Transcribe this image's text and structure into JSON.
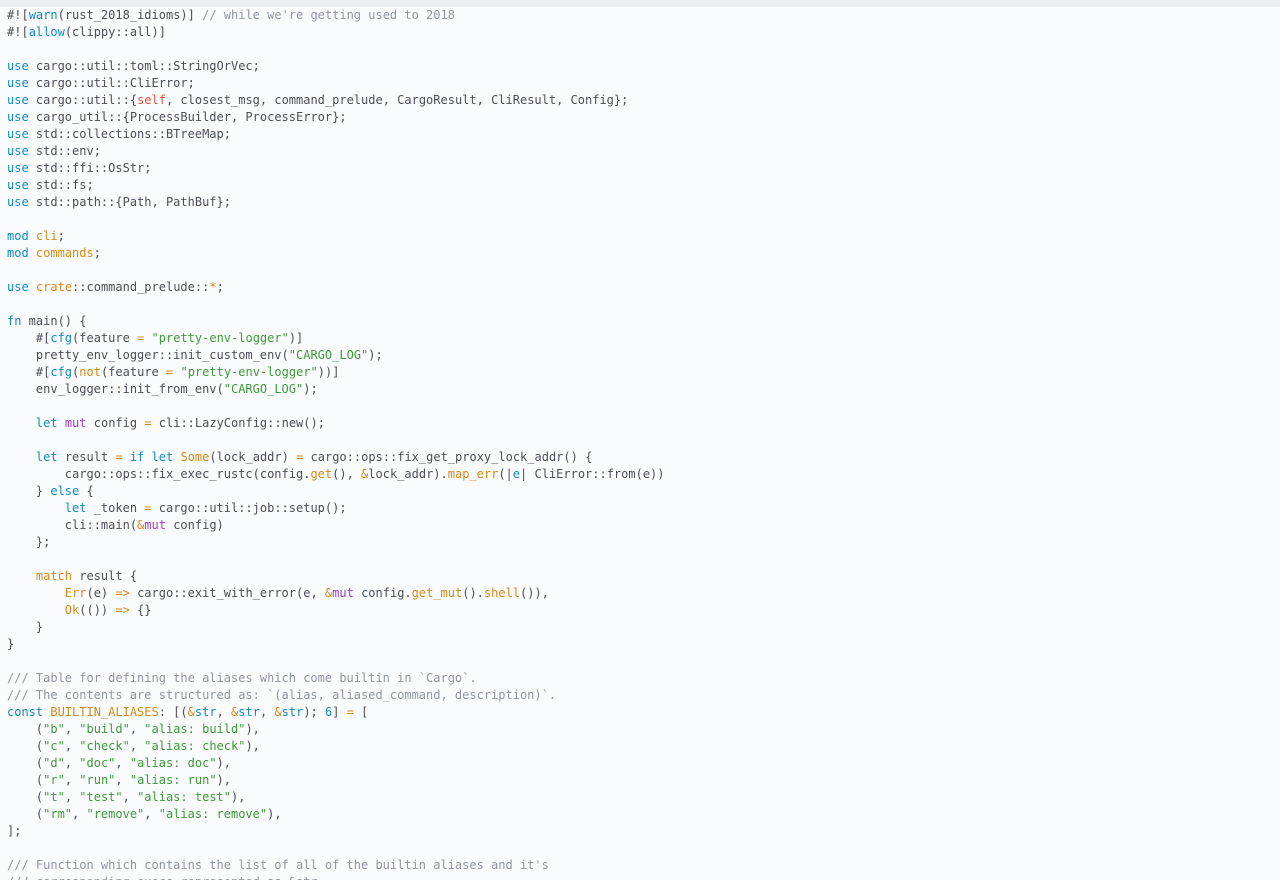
{
  "editor": {
    "language": "rust",
    "lines": [
      [
        [
          "pl",
          "#!["
        ],
        [
          "kw",
          "warn"
        ],
        [
          "pl",
          "(rust_2018_idioms)] "
        ],
        [
          "cm",
          "// while we're getting used to 2018"
        ]
      ],
      [
        [
          "pl",
          "#!["
        ],
        [
          "kw",
          "allow"
        ],
        [
          "pl",
          "(clippy::all)]"
        ]
      ],
      [],
      [
        [
          "kw",
          "use"
        ],
        [
          "pl",
          " cargo::util::toml::StringOrVec;"
        ]
      ],
      [
        [
          "kw",
          "use"
        ],
        [
          "pl",
          " cargo::util::CliError;"
        ]
      ],
      [
        [
          "kw",
          "use"
        ],
        [
          "pl",
          " cargo::util::{"
        ],
        [
          "sf",
          "self"
        ],
        [
          "pl",
          ", closest_msg, command_prelude, CargoResult, CliResult, Config};"
        ]
      ],
      [
        [
          "kw",
          "use"
        ],
        [
          "pl",
          " cargo_util::{ProcessBuilder, ProcessError};"
        ]
      ],
      [
        [
          "kw",
          "use"
        ],
        [
          "pl",
          " std::collections::BTreeMap;"
        ]
      ],
      [
        [
          "kw",
          "use"
        ],
        [
          "pl",
          " std::env;"
        ]
      ],
      [
        [
          "kw",
          "use"
        ],
        [
          "pl",
          " std::ffi::OsStr;"
        ]
      ],
      [
        [
          "kw",
          "use"
        ],
        [
          "pl",
          " std::fs;"
        ]
      ],
      [
        [
          "kw",
          "use"
        ],
        [
          "pl",
          " std::path::{Path, PathBuf};"
        ]
      ],
      [],
      [
        [
          "kw",
          "mod"
        ],
        [
          "pl",
          " "
        ],
        [
          "ty",
          "cli"
        ],
        [
          "pl",
          ";"
        ]
      ],
      [
        [
          "kw",
          "mod"
        ],
        [
          "pl",
          " "
        ],
        [
          "ty",
          "commands"
        ],
        [
          "pl",
          ";"
        ]
      ],
      [],
      [
        [
          "kw",
          "use"
        ],
        [
          "pl",
          " "
        ],
        [
          "ty",
          "crate"
        ],
        [
          "pl",
          "::command_prelude::"
        ],
        [
          "op",
          "*"
        ],
        [
          "pl",
          ";"
        ]
      ],
      [],
      [
        [
          "kw",
          "fn"
        ],
        [
          "pl",
          " main() {"
        ]
      ],
      [
        [
          "pl",
          "    #["
        ],
        [
          "kw",
          "cfg"
        ],
        [
          "pl",
          "(feature "
        ],
        [
          "op",
          "="
        ],
        [
          "pl",
          " "
        ],
        [
          "st",
          "\"pretty-env-logger\""
        ],
        [
          "pl",
          ")]"
        ]
      ],
      [
        [
          "pl",
          "    pretty_env_logger::init_custom_env("
        ],
        [
          "st",
          "\"CARGO_LOG\""
        ],
        [
          "pl",
          ");"
        ]
      ],
      [
        [
          "pl",
          "    #["
        ],
        [
          "kw",
          "cfg"
        ],
        [
          "pl",
          "("
        ],
        [
          "ty",
          "not"
        ],
        [
          "pl",
          "(feature "
        ],
        [
          "op",
          "="
        ],
        [
          "pl",
          " "
        ],
        [
          "st",
          "\"pretty-env-logger\""
        ],
        [
          "pl",
          "))]"
        ]
      ],
      [
        [
          "pl",
          "    env_logger::init_from_env("
        ],
        [
          "st",
          "\"CARGO_LOG\""
        ],
        [
          "pl",
          ");"
        ]
      ],
      [],
      [
        [
          "pl",
          "    "
        ],
        [
          "kw",
          "let"
        ],
        [
          "pl",
          " "
        ],
        [
          "mu",
          "mut"
        ],
        [
          "pl",
          " config "
        ],
        [
          "op",
          "="
        ],
        [
          "pl",
          " cli::LazyConfig::new();"
        ]
      ],
      [],
      [
        [
          "pl",
          "    "
        ],
        [
          "kw",
          "let"
        ],
        [
          "pl",
          " result "
        ],
        [
          "op",
          "="
        ],
        [
          "pl",
          " "
        ],
        [
          "kw",
          "if"
        ],
        [
          "pl",
          " "
        ],
        [
          "kw",
          "let"
        ],
        [
          "pl",
          " "
        ],
        [
          "ty",
          "Some"
        ],
        [
          "pl",
          "(lock_addr) "
        ],
        [
          "op",
          "="
        ],
        [
          "pl",
          " cargo::ops::fix_get_proxy_lock_addr() {"
        ]
      ],
      [
        [
          "pl",
          "        cargo::ops::fix_exec_rustc(config."
        ],
        [
          "ty",
          "get"
        ],
        [
          "pl",
          "(), "
        ],
        [
          "op",
          "&"
        ],
        [
          "pl",
          "lock_addr)."
        ],
        [
          "ty",
          "map_err"
        ],
        [
          "pl",
          "(|"
        ],
        [
          "kw",
          "e"
        ],
        [
          "pl",
          "| CliError::from(e))"
        ]
      ],
      [
        [
          "pl",
          "    } "
        ],
        [
          "kw",
          "else"
        ],
        [
          "pl",
          " {"
        ]
      ],
      [
        [
          "pl",
          "        "
        ],
        [
          "kw",
          "let"
        ],
        [
          "pl",
          " _token "
        ],
        [
          "op",
          "="
        ],
        [
          "pl",
          " cargo::util::job::setup();"
        ]
      ],
      [
        [
          "pl",
          "        cli::main("
        ],
        [
          "op",
          "&"
        ],
        [
          "mu",
          "mut"
        ],
        [
          "pl",
          " config)"
        ]
      ],
      [
        [
          "pl",
          "    };"
        ]
      ],
      [],
      [
        [
          "pl",
          "    "
        ],
        [
          "ty",
          "match"
        ],
        [
          "pl",
          " result {"
        ]
      ],
      [
        [
          "pl",
          "        "
        ],
        [
          "ty",
          "Err"
        ],
        [
          "pl",
          "(e) "
        ],
        [
          "op",
          "=>"
        ],
        [
          "pl",
          " cargo::exit_with_error(e, "
        ],
        [
          "op",
          "&"
        ],
        [
          "mu",
          "mut"
        ],
        [
          "pl",
          " config."
        ],
        [
          "ty",
          "get_mut"
        ],
        [
          "pl",
          "()."
        ],
        [
          "ty",
          "shell"
        ],
        [
          "pl",
          "()),"
        ]
      ],
      [
        [
          "pl",
          "        "
        ],
        [
          "ty",
          "Ok"
        ],
        [
          "pl",
          "(()) "
        ],
        [
          "op",
          "=>"
        ],
        [
          "pl",
          " {}"
        ]
      ],
      [
        [
          "pl",
          "    }"
        ]
      ],
      [
        [
          "pl",
          "}"
        ]
      ],
      [],
      [
        [
          "cm",
          "/// Table for defining the aliases which come builtin in `Cargo`."
        ]
      ],
      [
        [
          "cm",
          "/// The contents are structured as: `(alias, aliased_command, description)`."
        ]
      ],
      [
        [
          "kw",
          "const"
        ],
        [
          "pl",
          " "
        ],
        [
          "ty",
          "BUILTIN_ALIASES"
        ],
        [
          "pl",
          ": [("
        ],
        [
          "op",
          "&"
        ],
        [
          "kw",
          "str"
        ],
        [
          "pl",
          ", "
        ],
        [
          "op",
          "&"
        ],
        [
          "kw",
          "str"
        ],
        [
          "pl",
          ", "
        ],
        [
          "op",
          "&"
        ],
        [
          "kw",
          "str"
        ],
        [
          "pl",
          "); "
        ],
        [
          "kw",
          "6"
        ],
        [
          "pl",
          "] "
        ],
        [
          "op",
          "="
        ],
        [
          "pl",
          " ["
        ]
      ],
      [
        [
          "pl",
          "    ("
        ],
        [
          "st",
          "\"b\""
        ],
        [
          "pl",
          ", "
        ],
        [
          "st",
          "\"build\""
        ],
        [
          "pl",
          ", "
        ],
        [
          "st",
          "\"alias: build\""
        ],
        [
          "pl",
          "),"
        ]
      ],
      [
        [
          "pl",
          "    ("
        ],
        [
          "st",
          "\"c\""
        ],
        [
          "pl",
          ", "
        ],
        [
          "st",
          "\"check\""
        ],
        [
          "pl",
          ", "
        ],
        [
          "st",
          "\"alias: check\""
        ],
        [
          "pl",
          "),"
        ]
      ],
      [
        [
          "pl",
          "    ("
        ],
        [
          "st",
          "\"d\""
        ],
        [
          "pl",
          ", "
        ],
        [
          "st",
          "\"doc\""
        ],
        [
          "pl",
          ", "
        ],
        [
          "st",
          "\"alias: doc\""
        ],
        [
          "pl",
          "),"
        ]
      ],
      [
        [
          "pl",
          "    ("
        ],
        [
          "st",
          "\"r\""
        ],
        [
          "pl",
          ", "
        ],
        [
          "st",
          "\"run\""
        ],
        [
          "pl",
          ", "
        ],
        [
          "st",
          "\"alias: run\""
        ],
        [
          "pl",
          "),"
        ]
      ],
      [
        [
          "pl",
          "    ("
        ],
        [
          "st",
          "\"t\""
        ],
        [
          "pl",
          ", "
        ],
        [
          "st",
          "\"test\""
        ],
        [
          "pl",
          ", "
        ],
        [
          "st",
          "\"alias: test\""
        ],
        [
          "pl",
          "),"
        ]
      ],
      [
        [
          "pl",
          "    ("
        ],
        [
          "st",
          "\"rm\""
        ],
        [
          "pl",
          ", "
        ],
        [
          "st",
          "\"remove\""
        ],
        [
          "pl",
          ", "
        ],
        [
          "st",
          "\"alias: remove\""
        ],
        [
          "pl",
          "),"
        ]
      ],
      [
        [
          "pl",
          "];"
        ]
      ],
      [],
      [
        [
          "cm",
          "/// Function which contains the list of all of the builtin aliases and it's"
        ]
      ],
      [
        [
          "cm",
          "/// corresponding execs represented as &str."
        ]
      ]
    ]
  }
}
